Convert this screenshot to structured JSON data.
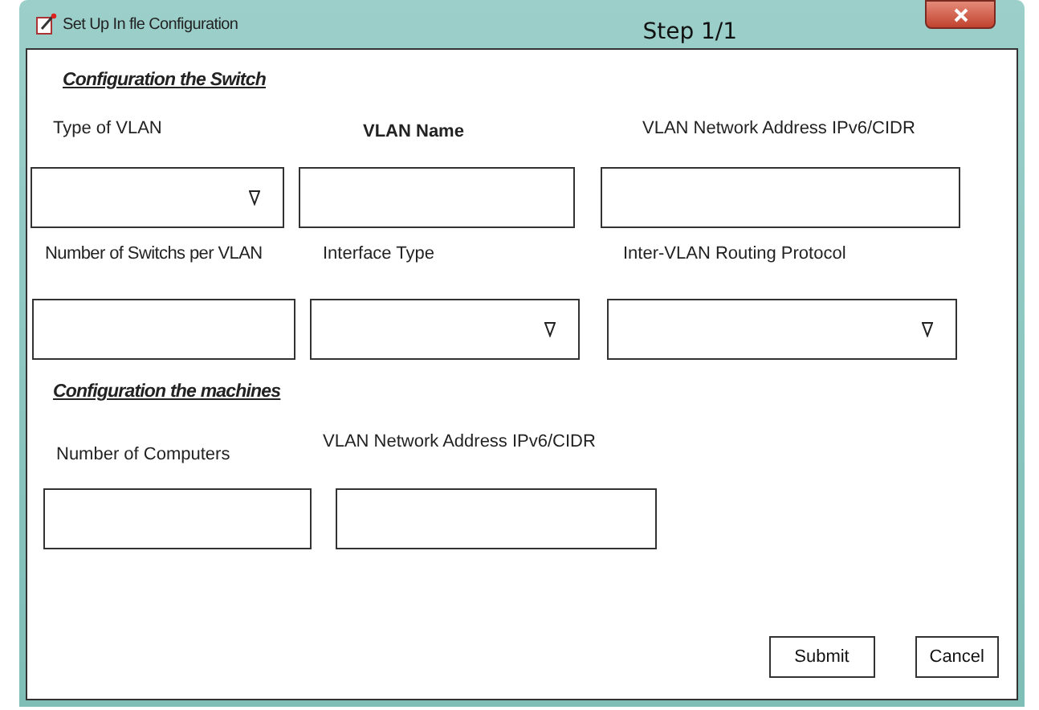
{
  "window": {
    "title": "Set Up In fle Configuration",
    "step": "Step 1/1"
  },
  "sections": [
    {
      "heading": "Configuration the Switch",
      "rows": [
        {
          "fields": [
            {
              "label": "Type of VLAN",
              "kind": "dropdown"
            },
            {
              "label": "VLAN Name",
              "kind": "text"
            },
            {
              "label": "VLAN Network Address IPv6/CIDR",
              "kind": "text"
            }
          ]
        },
        {
          "fields": [
            {
              "label": "Number of Switchs per VLAN",
              "kind": "text"
            },
            {
              "label": "Interface Type",
              "kind": "dropdown"
            },
            {
              "label": "Inter-VLAN Routing Protocol",
              "kind": "dropdown"
            }
          ]
        }
      ]
    },
    {
      "heading": "Configuration the machines",
      "rows": [
        {
          "fields": [
            {
              "label": "Number of Computers",
              "kind": "text"
            },
            {
              "label": "VLAN Network Address IPv6/CIDR",
              "kind": "text"
            }
          ]
        }
      ]
    }
  ],
  "buttons": [
    "Submit",
    "Cancel"
  ]
}
